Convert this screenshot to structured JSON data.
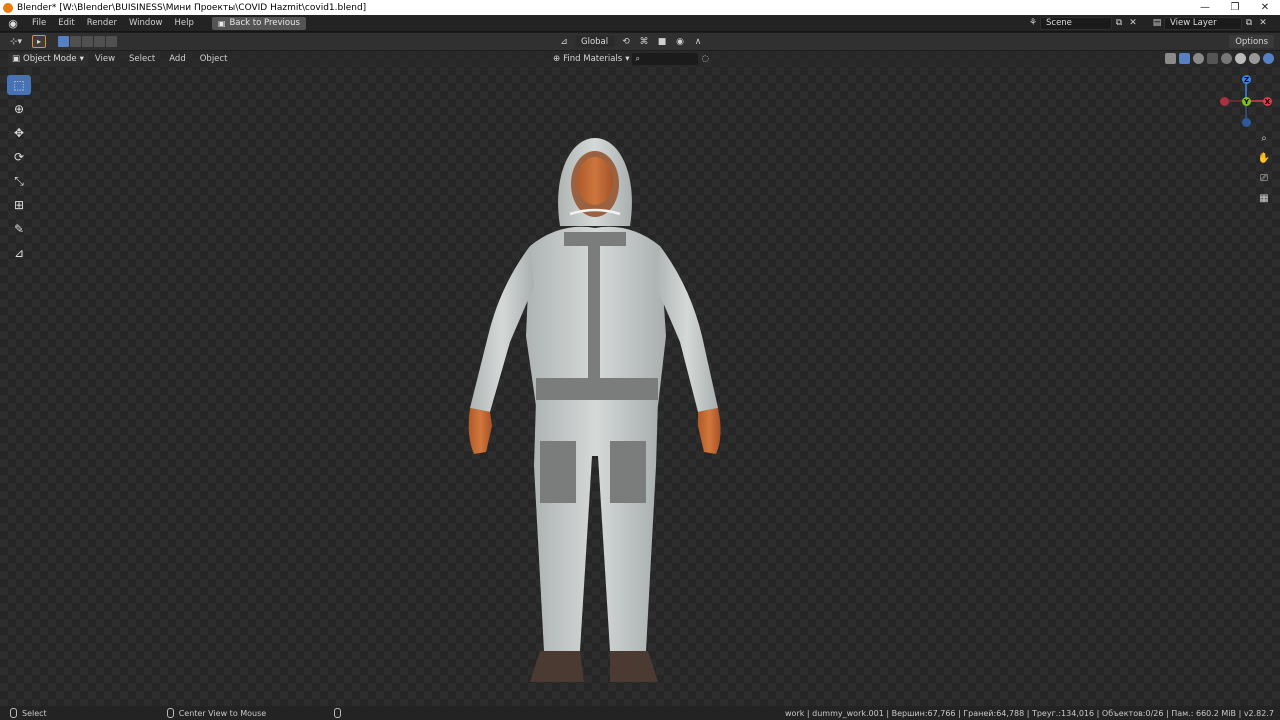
{
  "window": {
    "title": "Blender* [W:\\Blender\\BUISINESS\\Мини Проекты\\COVID Hazmit\\covid1.blend]",
    "minimize": "—",
    "maximize": "❐",
    "close": "✕"
  },
  "menubar": {
    "items": [
      "File",
      "Edit",
      "Render",
      "Window",
      "Help"
    ],
    "back_button": "Back to Previous",
    "scene_value": "Scene",
    "view_layer_value": "View Layer"
  },
  "toolheader": {
    "orientation": "Global",
    "options_label": "Options"
  },
  "viewport_header": {
    "mode": "Object Mode",
    "menus": [
      "View",
      "Select",
      "Add",
      "Object"
    ],
    "find_label": "Find Materials",
    "search_placeholder": ""
  },
  "gizmo": {
    "x_label": "X",
    "y_label": "Y",
    "z_label": "Z",
    "x_color": "#e03a4b",
    "y_color": "#80c21f",
    "z_color": "#3b84e8"
  },
  "statusbar": {
    "select_label": "Select",
    "center_label": "Center View to Mouse",
    "stats": "work | dummy_work.001 | Вершин:67,766 | Граней:64,788 | Треуг.:134,016 | Объектов:0/26 | Пам.: 660.2 MiB | v2.82.7"
  },
  "colors": {
    "accent": "#4772b3",
    "active_tool_border": "#e09030",
    "suit": "#c9cfce",
    "suit_trim": "#7a7d7c",
    "skin": "#c46a34",
    "boots": "#4a3a32"
  }
}
